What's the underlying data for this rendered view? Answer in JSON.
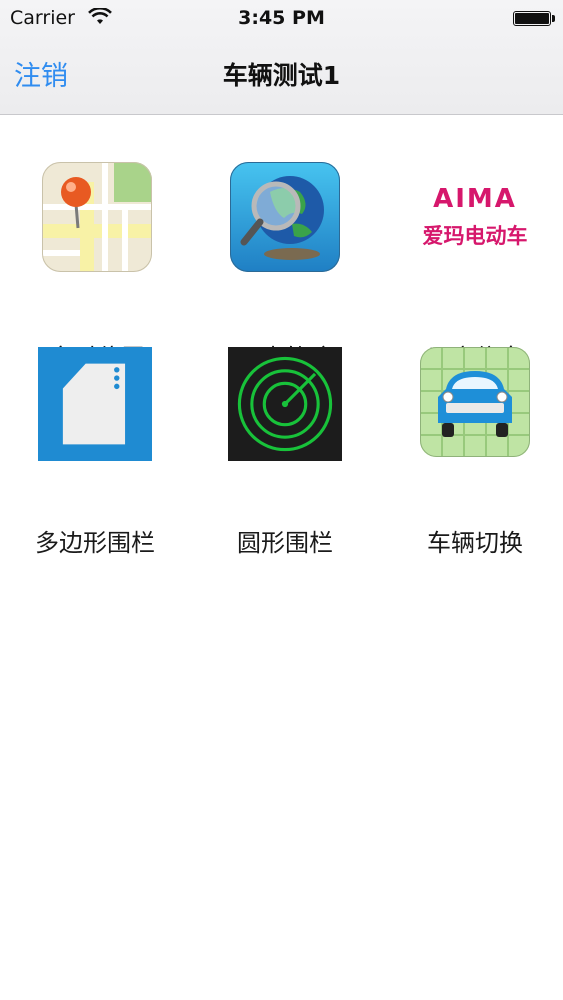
{
  "status_bar": {
    "carrier": "Carrier",
    "time": "3:45 PM"
  },
  "nav": {
    "left_button": "注销",
    "title": "车辆测试1"
  },
  "menu": [
    {
      "label": "实时位置",
      "icon": "map-pin-icon"
    },
    {
      "label": "历史轨迹",
      "icon": "globe-magnifier-icon"
    },
    {
      "label": "用户信息",
      "icon": "aima-logo-icon"
    },
    {
      "label": "多边形围栏",
      "icon": "polygon-fence-icon"
    },
    {
      "label": "圆形围栏",
      "icon": "radar-circle-icon"
    },
    {
      "label": "车辆切换",
      "icon": "car-icon"
    }
  ],
  "logo": {
    "brand_text": "AIMA",
    "brand_cn": "爱玛电动车"
  },
  "colors": {
    "accent": "#2f8cf0",
    "brand": "#d6176c",
    "radar": "#18c23a"
  }
}
